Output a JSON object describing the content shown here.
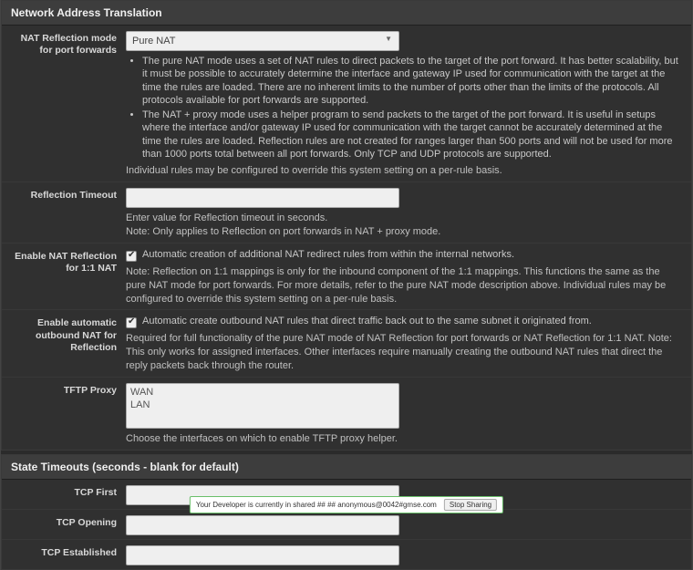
{
  "nat": {
    "title": "Network Address Translation",
    "reflection_mode": {
      "label": "NAT Reflection mode for port forwards",
      "value": "Pure NAT",
      "bullet1": "The pure NAT mode uses a set of NAT rules to direct packets to the target of the port forward. It has better scalability, but it must be possible to accurately determine the interface and gateway IP used for communication with the target at the time the rules are loaded. There are no inherent limits to the number of ports other than the limits of the protocols. All protocols available for port forwards are supported.",
      "bullet2": "The NAT + proxy mode uses a helper program to send packets to the target of the port forward. It is useful in setups where the interface and/or gateway IP used for communication with the target cannot be accurately determined at the time the rules are loaded. Reflection rules are not created for ranges larger than 500 ports and will not be used for more than 1000 ports total between all port forwards. Only TCP and UDP protocols are supported.",
      "footer": "Individual rules may be configured to override this system setting on a per-rule basis."
    },
    "reflection_timeout": {
      "label": "Reflection Timeout",
      "value": "",
      "help1": "Enter value for Reflection timeout in seconds.",
      "help2": "Note: Only applies to Reflection on port forwards in NAT + proxy mode."
    },
    "nat_1to1": {
      "label": "Enable NAT Reflection for 1:1 NAT",
      "checkbox_label": "Automatic creation of additional NAT redirect rules from within the internal networks.",
      "help": "Note: Reflection on 1:1 mappings is only for the inbound component of the 1:1 mappings. This functions the same as the pure NAT mode for port forwards. For more details, refer to the pure NAT mode description above. Individual rules may be configured to override this system setting on a per-rule basis."
    },
    "auto_outbound": {
      "label": "Enable automatic outbound NAT for Reflection",
      "checkbox_label": "Automatic create outbound NAT rules that direct traffic back out to the same subnet it originated from.",
      "help": "Required for full functionality of the pure NAT mode of NAT Reflection for port forwards or NAT Reflection for 1:1 NAT. Note: This only works for assigned interfaces. Other interfaces require manually creating the outbound NAT rules that direct the reply packets back through the router."
    },
    "tftp": {
      "label": "TFTP Proxy",
      "options": [
        "WAN",
        "LAN"
      ],
      "help": "Choose the interfaces on which to enable TFTP proxy helper."
    }
  },
  "timeouts": {
    "title": "State Timeouts (seconds - blank for default)",
    "tcp_first": {
      "label": "TCP First",
      "value": ""
    },
    "tcp_opening": {
      "label": "TCP Opening",
      "value": ""
    },
    "tcp_established": {
      "label": "TCP Established",
      "value": ""
    }
  },
  "debug": {
    "text": "Your Developer is currently in shared ## ## anonymous@0042#gmse.com",
    "button": "Stop Sharing"
  }
}
